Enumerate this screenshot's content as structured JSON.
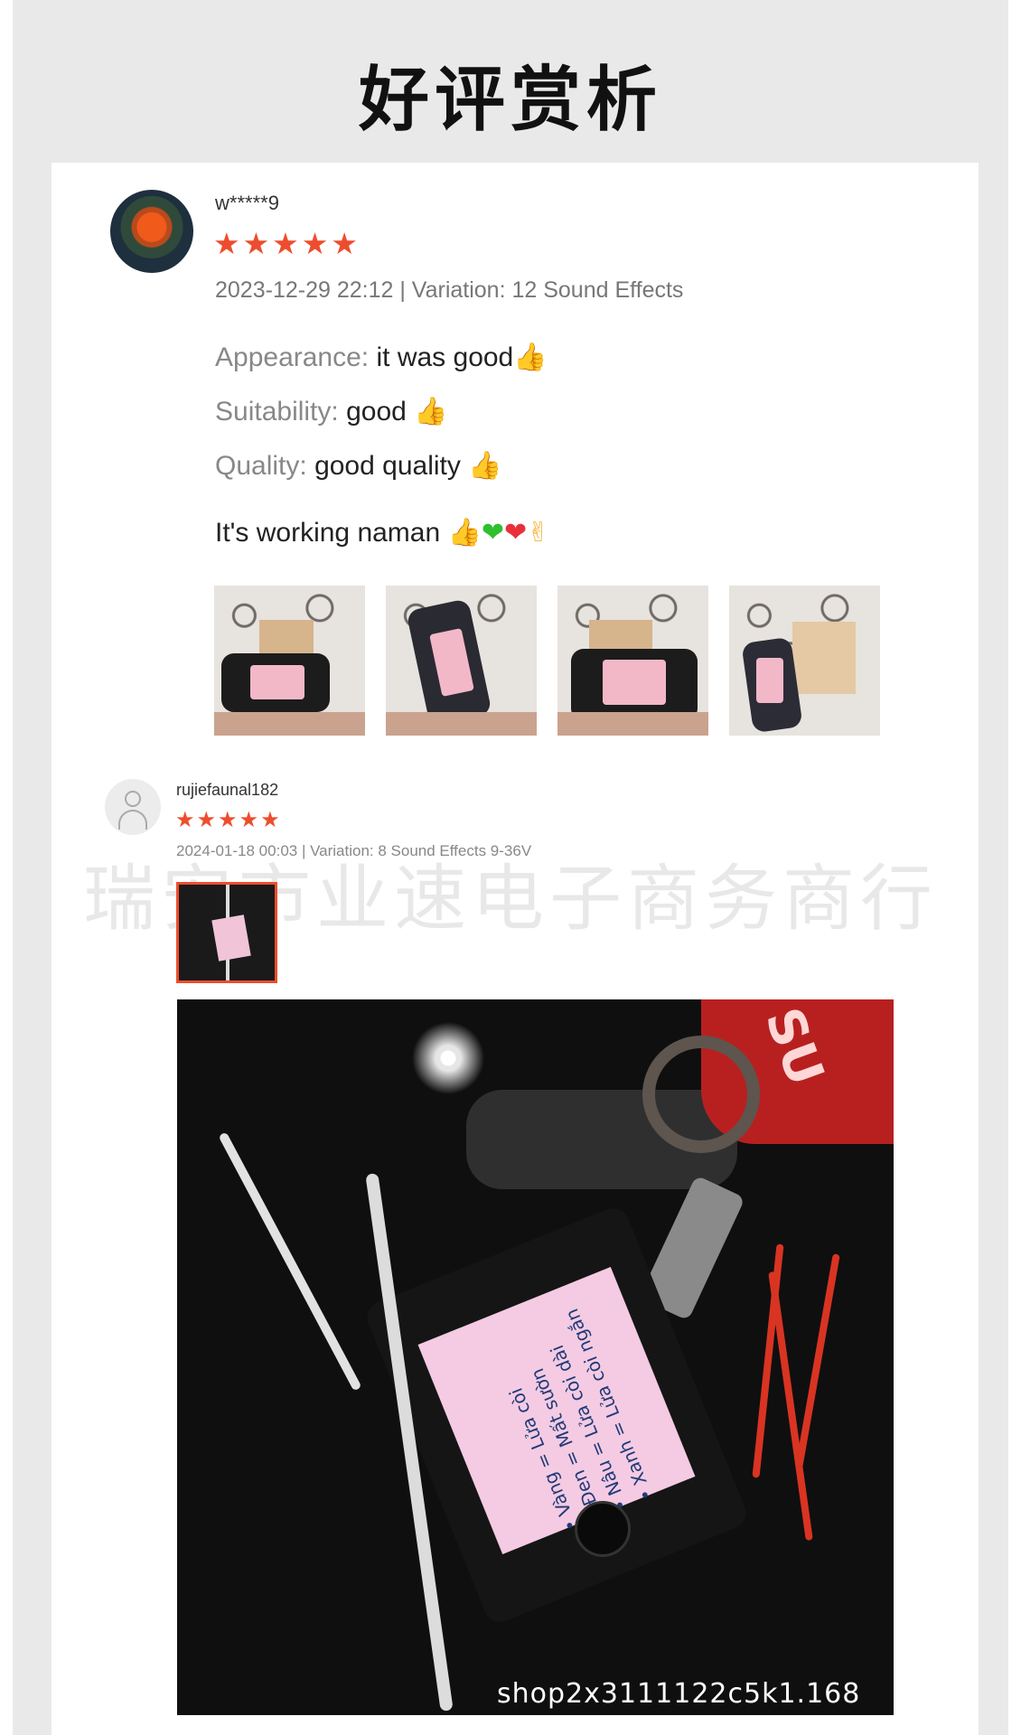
{
  "page": {
    "title": "好评赏析"
  },
  "reviews": [
    {
      "username": "w*****9",
      "rating_stars": "★★★★★",
      "rating": 5,
      "meta": "2023-12-29 22:12 | Variation: 12 Sound Effects",
      "appearance_label": "Appearance:",
      "appearance_value": "it was good",
      "suitability_label": "Suitability:",
      "suitability_value": "good",
      "quality_label": "Quality:",
      "quality_value": "good quality",
      "comment": "It's working naman",
      "photo_count": 4
    },
    {
      "username": "rujiefaunal182",
      "rating_stars": "★★★★★",
      "rating": 5,
      "meta": "2024-01-18 00:03 | Variation: 8 Sound Effects 9-36V",
      "large_photo_label_lines": [
        "• Vàng = Lửa còi",
        "• Đen = Mất sườn",
        "• Nâu = Lửa còi dài",
        "• Xanh = Lửa còi ngắn"
      ]
    }
  ],
  "watermark": "瑞安市业速电子商务商行",
  "shop_watermark": "shop2x3111122c5k1.168",
  "icons": {
    "thumbs_up": "thumbs-up-icon",
    "green_heart": "green-heart-icon",
    "red_heart": "red-heart-icon",
    "fingers_crossed": "fingers-crossed-icon",
    "default_avatar": "user-placeholder-icon",
    "star": "star-icon"
  },
  "colors": {
    "accent": "#ee4d2d",
    "background": "#e9e9e9",
    "card": "#ffffff"
  }
}
